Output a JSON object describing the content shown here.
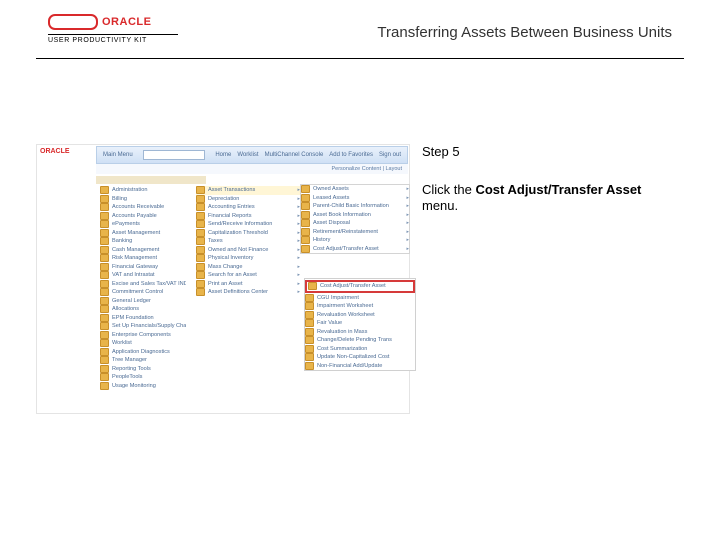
{
  "header": {
    "brand_word": "ORACLE",
    "brand_sub": "USER PRODUCTIVITY KIT",
    "title": "Transferring Assets Between Business Units"
  },
  "step": {
    "label": "Step 5"
  },
  "instruction": {
    "prefix": "Click the ",
    "bold": "Cost Adjust/Transfer Asset",
    "suffix": " menu."
  },
  "shot": {
    "logo": "ORACLE",
    "search_label": "Main Menu",
    "nav_items": [
      "Home",
      "Worklist",
      "MultiChannel Console",
      "Add to Favorites",
      "Sign out"
    ],
    "subbar": "Personalize Content  |  Layout",
    "col1": [
      "Administration",
      "Billing",
      "Accounts Receivable",
      "Accounts Payable",
      "ePayments",
      "Asset Management",
      "Banking",
      "Cash Management",
      "Risk Management",
      "Financial Gateway",
      "VAT and Intrastat",
      "Excise and Sales Tax/VAT IND",
      "Commitment Control",
      "General Ledger",
      "Allocations",
      "EPM Foundation",
      "Set Up Financials/Supply Chain",
      "Enterprise Components",
      "Worklist",
      "Application Diagnostics",
      "Tree Manager",
      "Reporting Tools",
      "PeopleTools",
      "Usage Monitoring"
    ],
    "col2": [
      "Asset Transactions",
      "Depreciation",
      "Accounting Entries",
      "Financial Reports",
      "Send/Receive Information",
      "Capitalization Threshold",
      "Taxes",
      "Owned and Not Finance",
      "Physical Inventory",
      "Mass Change",
      "Search for an Asset",
      "Print an Asset",
      "Asset Definitions Center"
    ],
    "col3": [
      "Owned Assets",
      "Leased Assets",
      "Parent-Child Basic Information",
      "Asset Book Information",
      "Asset Disposal",
      "Retirement/Reinstatement",
      "History",
      "Cost Adjust/Transfer Asset"
    ],
    "col4": [
      "Cost Adjust/Transfer Asset",
      "CGU Impairment",
      "Impairment Worksheet",
      "Revaluation Worksheet",
      "Fair Value",
      "Revaluation in Mass",
      "Change/Delete Pending Trans",
      "Cost Summarization",
      "Update Non-Capitalized Cost",
      "Non-Financial Add/Update"
    ]
  }
}
